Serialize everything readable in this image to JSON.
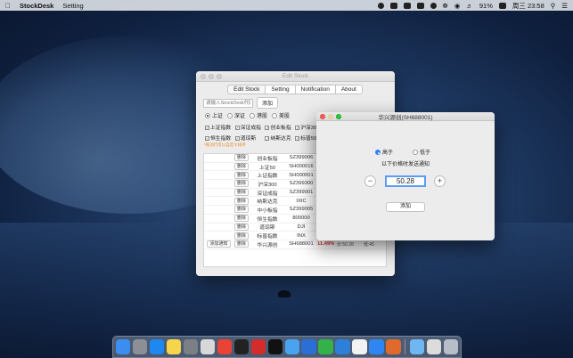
{
  "menubar": {
    "app_name": "StockDesk",
    "menu_setting": "Setting",
    "battery": "91%",
    "clock": "周三 23:58"
  },
  "main_window": {
    "title": "Edit Stock",
    "tabs": [
      "Edit Stock",
      "Setting",
      "Notification",
      "About"
    ],
    "search_placeholder": "请输入StockDesk代码",
    "add_button": "添加",
    "markets": [
      "上证",
      "深证",
      "港股",
      "美股"
    ],
    "selected_market": "上证",
    "index_checks": [
      "上证指数",
      "深证成指",
      "创业板指",
      "沪深300",
      "恒生指数",
      "道琼斯",
      "纳斯达克",
      "标普500"
    ],
    "hint": "*拖动行可以自定义排序",
    "rows": [
      {
        "delete": "删除",
        "name": "创业板指",
        "code": "SZ399006"
      },
      {
        "delete": "删除",
        "name": "上证50",
        "code": "SH000016"
      },
      {
        "delete": "删除",
        "name": "上证指数",
        "code": "SH000001"
      },
      {
        "delete": "删除",
        "name": "沪深300",
        "code": "SZ399300"
      },
      {
        "delete": "删除",
        "name": "深证成指",
        "code": "SZ399001"
      },
      {
        "delete": "删除",
        "name": "纳斯达克",
        "code": "IXIC"
      },
      {
        "delete": "删除",
        "name": "中小板指",
        "code": "SZ399005"
      },
      {
        "delete": "删除",
        "name": "恒生指数",
        "code": "800000"
      },
      {
        "delete": "删除",
        "name": "道琼斯",
        "code": "DJI"
      },
      {
        "delete": "删除",
        "name": "标普指数",
        "code": "INX"
      },
      {
        "notify": "添加通知",
        "delete": "删除",
        "name": "华兴源创",
        "code": "SH688001",
        "pct": "11.49%",
        "price": "价:50.28",
        "time": "低:45"
      }
    ]
  },
  "dialog": {
    "title": "华兴源创(SH688001)",
    "option_above": "高于",
    "option_below": "低于",
    "selected": "高于",
    "label": "以下价格时发送通知",
    "minus": "−",
    "price": "50.28",
    "plus": "+",
    "add_button": "添加"
  },
  "dock": {
    "icons": [
      "finder-icon",
      "launchpad-icon",
      "safari-icon",
      "notes-icon",
      "system-preferences-icon",
      "screenshot-icon",
      "chrome-icon",
      "terminal-icon",
      "netease-icon",
      "qq-icon",
      "preview-icon",
      "xcode-icon",
      "media-icon",
      "maps-icon",
      "textedit-icon",
      "appstore-icon",
      "books-icon",
      "folder-icon",
      "window-icon",
      "trash-icon"
    ],
    "colors": [
      "#3b8ef0",
      "#8c8f96",
      "#1f87f0",
      "#f7d54a",
      "#7b7f86",
      "#d8d8d8",
      "#e94335",
      "#222222",
      "#d42b2b",
      "#111111",
      "#4aa3f0",
      "#2a6fd6",
      "#35b14a",
      "#2e7fd9",
      "#f2f2f2",
      "#2f86f2",
      "#e06a2b",
      "#6fb7f2",
      "#dcdcdc",
      "#b8bec8"
    ]
  }
}
